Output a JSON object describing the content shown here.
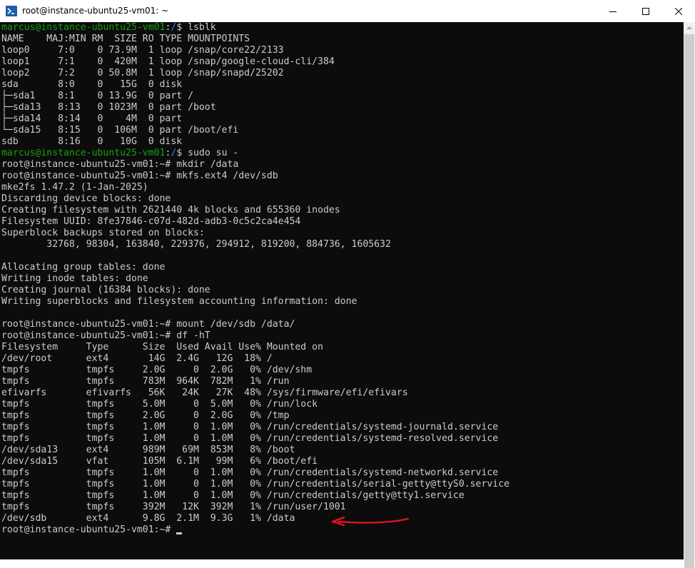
{
  "window": {
    "title": "root@instance-ubuntu25-vm01: ~",
    "icons": [
      "powershell-icon",
      "minimize-icon",
      "maximize-icon",
      "close-icon",
      "scroll-up-icon"
    ]
  },
  "accent_colors": {
    "prompt_user": "#13a10e",
    "prompt_path": "#3b78ff",
    "text": "#cccccc",
    "annotation_arrow": "#e81123"
  },
  "terminal": {
    "lines": [
      {
        "user": "marcus@instance-ubuntu25-vm01",
        "sep": ":",
        "path": "/",
        "cmd": "$ lsblk"
      },
      {
        "text": "NAME    MAJ:MIN RM  SIZE RO TYPE MOUNTPOINTS"
      },
      {
        "text": "loop0     7:0    0 73.9M  1 loop /snap/core22/2133"
      },
      {
        "text": "loop1     7:1    0  420M  1 loop /snap/google-cloud-cli/384"
      },
      {
        "text": "loop2     7:2    0 50.8M  1 loop /snap/snapd/25202"
      },
      {
        "text": "sda       8:0    0   15G  0 disk"
      },
      {
        "text": "├─sda1    8:1    0 13.9G  0 part /"
      },
      {
        "text": "├─sda13   8:13   0 1023M  0 part /boot"
      },
      {
        "text": "├─sda14   8:14   0    4M  0 part"
      },
      {
        "text": "└─sda15   8:15   0  106M  0 part /boot/efi"
      },
      {
        "text": "sdb       8:16   0   10G  0 disk"
      },
      {
        "user": "marcus@instance-ubuntu25-vm01",
        "sep": ":",
        "path": "/",
        "cmd": "$ sudo su -"
      },
      {
        "text": "root@instance-ubuntu25-vm01:~# mkdir /data"
      },
      {
        "text": "root@instance-ubuntu25-vm01:~# mkfs.ext4 /dev/sdb"
      },
      {
        "text": "mke2fs 1.47.2 (1-Jan-2025)"
      },
      {
        "text": "Discarding device blocks: done"
      },
      {
        "text": "Creating filesystem with 2621440 4k blocks and 655360 inodes"
      },
      {
        "text": "Filesystem UUID: 8fe37846-c07d-482d-adb3-0c5c2ca4e454"
      },
      {
        "text": "Superblock backups stored on blocks:"
      },
      {
        "text": "        32768, 98304, 163840, 229376, 294912, 819200, 884736, 1605632"
      },
      {
        "text": ""
      },
      {
        "text": "Allocating group tables: done"
      },
      {
        "text": "Writing inode tables: done"
      },
      {
        "text": "Creating journal (16384 blocks): done"
      },
      {
        "text": "Writing superblocks and filesystem accounting information: done"
      },
      {
        "text": ""
      },
      {
        "text": "root@instance-ubuntu25-vm01:~# mount /dev/sdb /data/"
      },
      {
        "text": "root@instance-ubuntu25-vm01:~# df -hT"
      },
      {
        "text": "Filesystem     Type      Size  Used Avail Use% Mounted on"
      },
      {
        "text": "/dev/root      ext4       14G  2.4G   12G  18% /"
      },
      {
        "text": "tmpfs          tmpfs     2.0G     0  2.0G   0% /dev/shm"
      },
      {
        "text": "tmpfs          tmpfs     783M  964K  782M   1% /run"
      },
      {
        "text": "efivarfs       efivarfs   56K   24K   27K  48% /sys/firmware/efi/efivars"
      },
      {
        "text": "tmpfs          tmpfs     5.0M     0  5.0M   0% /run/lock"
      },
      {
        "text": "tmpfs          tmpfs     2.0G     0  2.0G   0% /tmp"
      },
      {
        "text": "tmpfs          tmpfs     1.0M     0  1.0M   0% /run/credentials/systemd-journald.service"
      },
      {
        "text": "tmpfs          tmpfs     1.0M     0  1.0M   0% /run/credentials/systemd-resolved.service"
      },
      {
        "text": "/dev/sda13     ext4      989M   69M  853M   8% /boot"
      },
      {
        "text": "/dev/sda15     vfat      105M  6.1M   99M   6% /boot/efi"
      },
      {
        "text": "tmpfs          tmpfs     1.0M     0  1.0M   0% /run/credentials/systemd-networkd.service"
      },
      {
        "text": "tmpfs          tmpfs     1.0M     0  1.0M   0% /run/credentials/serial-getty@ttyS0.service"
      },
      {
        "text": "tmpfs          tmpfs     1.0M     0  1.0M   0% /run/credentials/getty@tty1.service"
      },
      {
        "text": "tmpfs          tmpfs     392M   12K  392M   1% /run/user/1001"
      },
      {
        "text": "/dev/sdb       ext4      9.8G  2.1M  9.3G   1% /data"
      },
      {
        "text": "root@instance-ubuntu25-vm01:~# ",
        "cursor": true
      }
    ]
  }
}
